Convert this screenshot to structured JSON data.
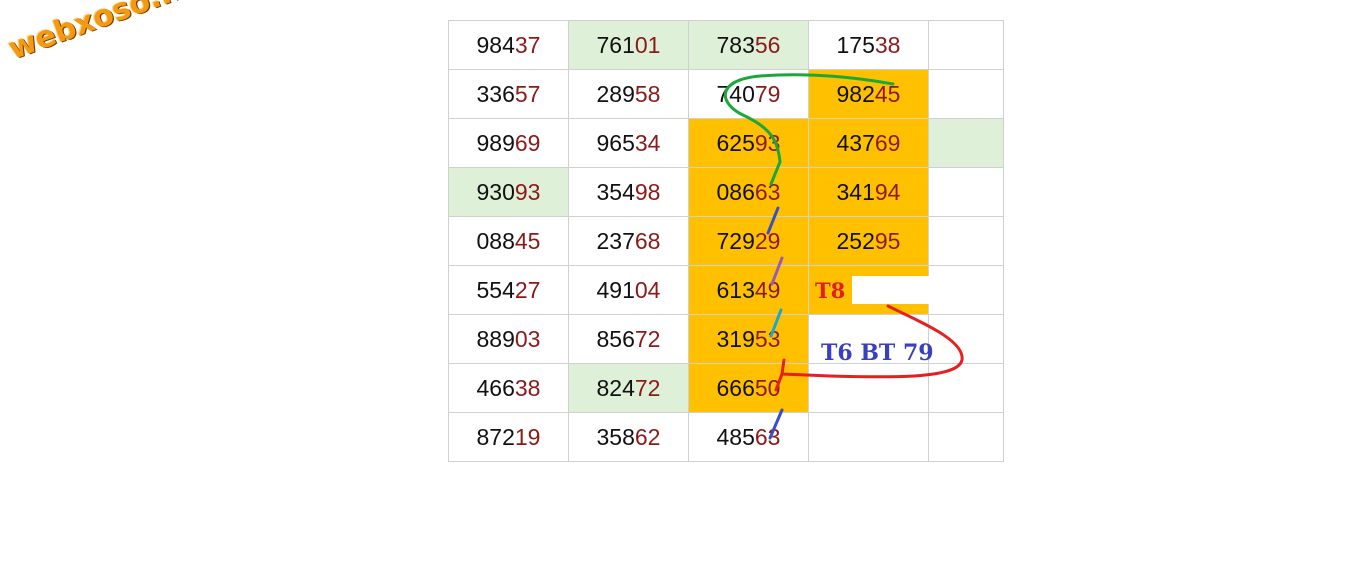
{
  "logo_text": "webxoso.net",
  "rows": [
    [
      {
        "h": "984",
        "t": "37",
        "bg": ""
      },
      {
        "h": "761",
        "t": "01",
        "bg": "green"
      },
      {
        "h": "783",
        "t": "56",
        "bg": "green"
      },
      {
        "h": "175",
        "t": "38",
        "bg": ""
      },
      {
        "h": "",
        "t": "",
        "bg": ""
      }
    ],
    [
      {
        "h": "336",
        "t": "57",
        "bg": ""
      },
      {
        "h": "289",
        "t": "58",
        "bg": ""
      },
      {
        "h": "740",
        "t": "79",
        "bg": ""
      },
      {
        "h": "982",
        "t": "45",
        "bg": "orange"
      },
      {
        "h": "",
        "t": "",
        "bg": ""
      }
    ],
    [
      {
        "h": "989",
        "t": "69",
        "bg": ""
      },
      {
        "h": "965",
        "t": "34",
        "bg": ""
      },
      {
        "h": "625",
        "t": "93",
        "bg": "orange"
      },
      {
        "h": "437",
        "t": "69",
        "bg": "orange"
      },
      {
        "h": "",
        "t": "",
        "bg": "green"
      }
    ],
    [
      {
        "h": "930",
        "t": "93",
        "bg": "green"
      },
      {
        "h": "354",
        "t": "98",
        "bg": ""
      },
      {
        "h": "086",
        "t": "63",
        "bg": "orange"
      },
      {
        "h": "341",
        "t": "94",
        "bg": "orange"
      },
      {
        "h": "",
        "t": "",
        "bg": ""
      }
    ],
    [
      {
        "h": "088",
        "t": "45",
        "bg": ""
      },
      {
        "h": "237",
        "t": "68",
        "bg": ""
      },
      {
        "h": "729",
        "t": "29",
        "bg": "orange"
      },
      {
        "h": "252",
        "t": "95",
        "bg": "orange"
      },
      {
        "h": "",
        "t": "",
        "bg": ""
      }
    ],
    [
      {
        "h": "554",
        "t": "27",
        "bg": ""
      },
      {
        "h": "491",
        "t": "04",
        "bg": ""
      },
      {
        "h": "613",
        "t": "49",
        "bg": "orange"
      },
      {
        "h": "",
        "t": "",
        "bg": "orange"
      },
      {
        "h": "",
        "t": "",
        "bg": ""
      }
    ],
    [
      {
        "h": "889",
        "t": "03",
        "bg": ""
      },
      {
        "h": "856",
        "t": "72",
        "bg": ""
      },
      {
        "h": "319",
        "t": "53",
        "bg": "orange"
      },
      {
        "h": "",
        "t": "",
        "bg": ""
      },
      {
        "h": "",
        "t": "",
        "bg": ""
      }
    ],
    [
      {
        "h": "466",
        "t": "38",
        "bg": ""
      },
      {
        "h": "824",
        "t": "72",
        "bg": "green"
      },
      {
        "h": "666",
        "t": "50",
        "bg": "orange"
      },
      {
        "h": "",
        "t": "",
        "bg": ""
      },
      {
        "h": "",
        "t": "",
        "bg": ""
      }
    ],
    [
      {
        "h": "872",
        "t": "19",
        "bg": ""
      },
      {
        "h": "358",
        "t": "62",
        "bg": ""
      },
      {
        "h": "485",
        "t": "63",
        "bg": ""
      },
      {
        "h": "",
        "t": "",
        "bg": ""
      },
      {
        "h": "",
        "t": "",
        "bg": ""
      }
    ]
  ],
  "notes": {
    "t8": "T8",
    "bt": "T6 BT 79"
  },
  "colors": {
    "orange": "#ffc000",
    "green": "#dff0d8",
    "tail": "#8b1a1a",
    "red_note": "#e02020",
    "blue_note": "#3a3fbf"
  }
}
